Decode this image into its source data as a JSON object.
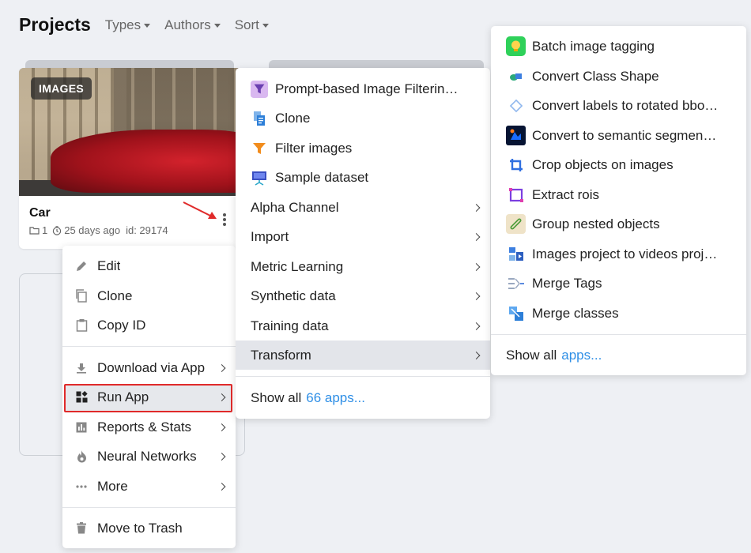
{
  "header": {
    "title": "Projects",
    "filters": [
      "Types",
      "Authors",
      "Sort"
    ]
  },
  "card": {
    "badge": "IMAGES",
    "name": "Car",
    "count": "1",
    "time": "25 days ago",
    "id_text": "id: 29174"
  },
  "menu1": {
    "items": [
      {
        "label": "Edit",
        "icon": "pencil-icon"
      },
      {
        "label": "Clone",
        "icon": "copy-icon"
      },
      {
        "label": "Copy ID",
        "icon": "clipboard-icon"
      },
      {
        "label": "Download via App",
        "icon": "download-icon"
      },
      {
        "label": "Run App",
        "icon": "apps-grid-icon"
      },
      {
        "label": "Reports & Stats",
        "icon": "bar-chart-icon"
      },
      {
        "label": "Neural Networks",
        "icon": "flame-icon"
      },
      {
        "label": "More",
        "icon": "dots-icon"
      },
      {
        "label": "Move to Trash",
        "icon": "trash-icon"
      }
    ]
  },
  "menu2": {
    "items": [
      {
        "label": "Prompt-based Image Filterin…",
        "icon": "funnel-prompt-icon"
      },
      {
        "label": "Clone",
        "icon": "clone-doc-icon"
      },
      {
        "label": "Filter images",
        "icon": "funnel-orange-icon"
      },
      {
        "label": "Sample dataset",
        "icon": "sample-dataset-icon"
      },
      {
        "label": "Alpha Channel"
      },
      {
        "label": "Import"
      },
      {
        "label": "Metric Learning"
      },
      {
        "label": "Synthetic data"
      },
      {
        "label": "Training data"
      },
      {
        "label": "Transform"
      }
    ],
    "show_all": "Show all",
    "show_all_link": "66 apps..."
  },
  "menu3": {
    "items": [
      {
        "label": "Batch image tagging",
        "icon": "bulb-icon"
      },
      {
        "label": "Convert Class Shape",
        "icon": "shapes-icon"
      },
      {
        "label": "Convert labels to rotated bbo…",
        "icon": "rotated-box-icon"
      },
      {
        "label": "Convert to semantic segmen…",
        "icon": "segmentation-icon"
      },
      {
        "label": "Crop objects on images",
        "icon": "crop-icon"
      },
      {
        "label": "Extract rois",
        "icon": "roi-icon"
      },
      {
        "label": "Group nested objects",
        "icon": "link-icon"
      },
      {
        "label": "Images project to videos proj…",
        "icon": "video-project-icon"
      },
      {
        "label": "Merge Tags",
        "icon": "merge-tags-icon"
      },
      {
        "label": "Merge classes",
        "icon": "merge-classes-icon"
      }
    ],
    "show_all": "Show all",
    "show_all_link": "apps..."
  },
  "colors": {
    "accent_link": "#2f8fe6",
    "highlight_border": "#e02a2a",
    "active_bg": "#e3e5ea"
  }
}
